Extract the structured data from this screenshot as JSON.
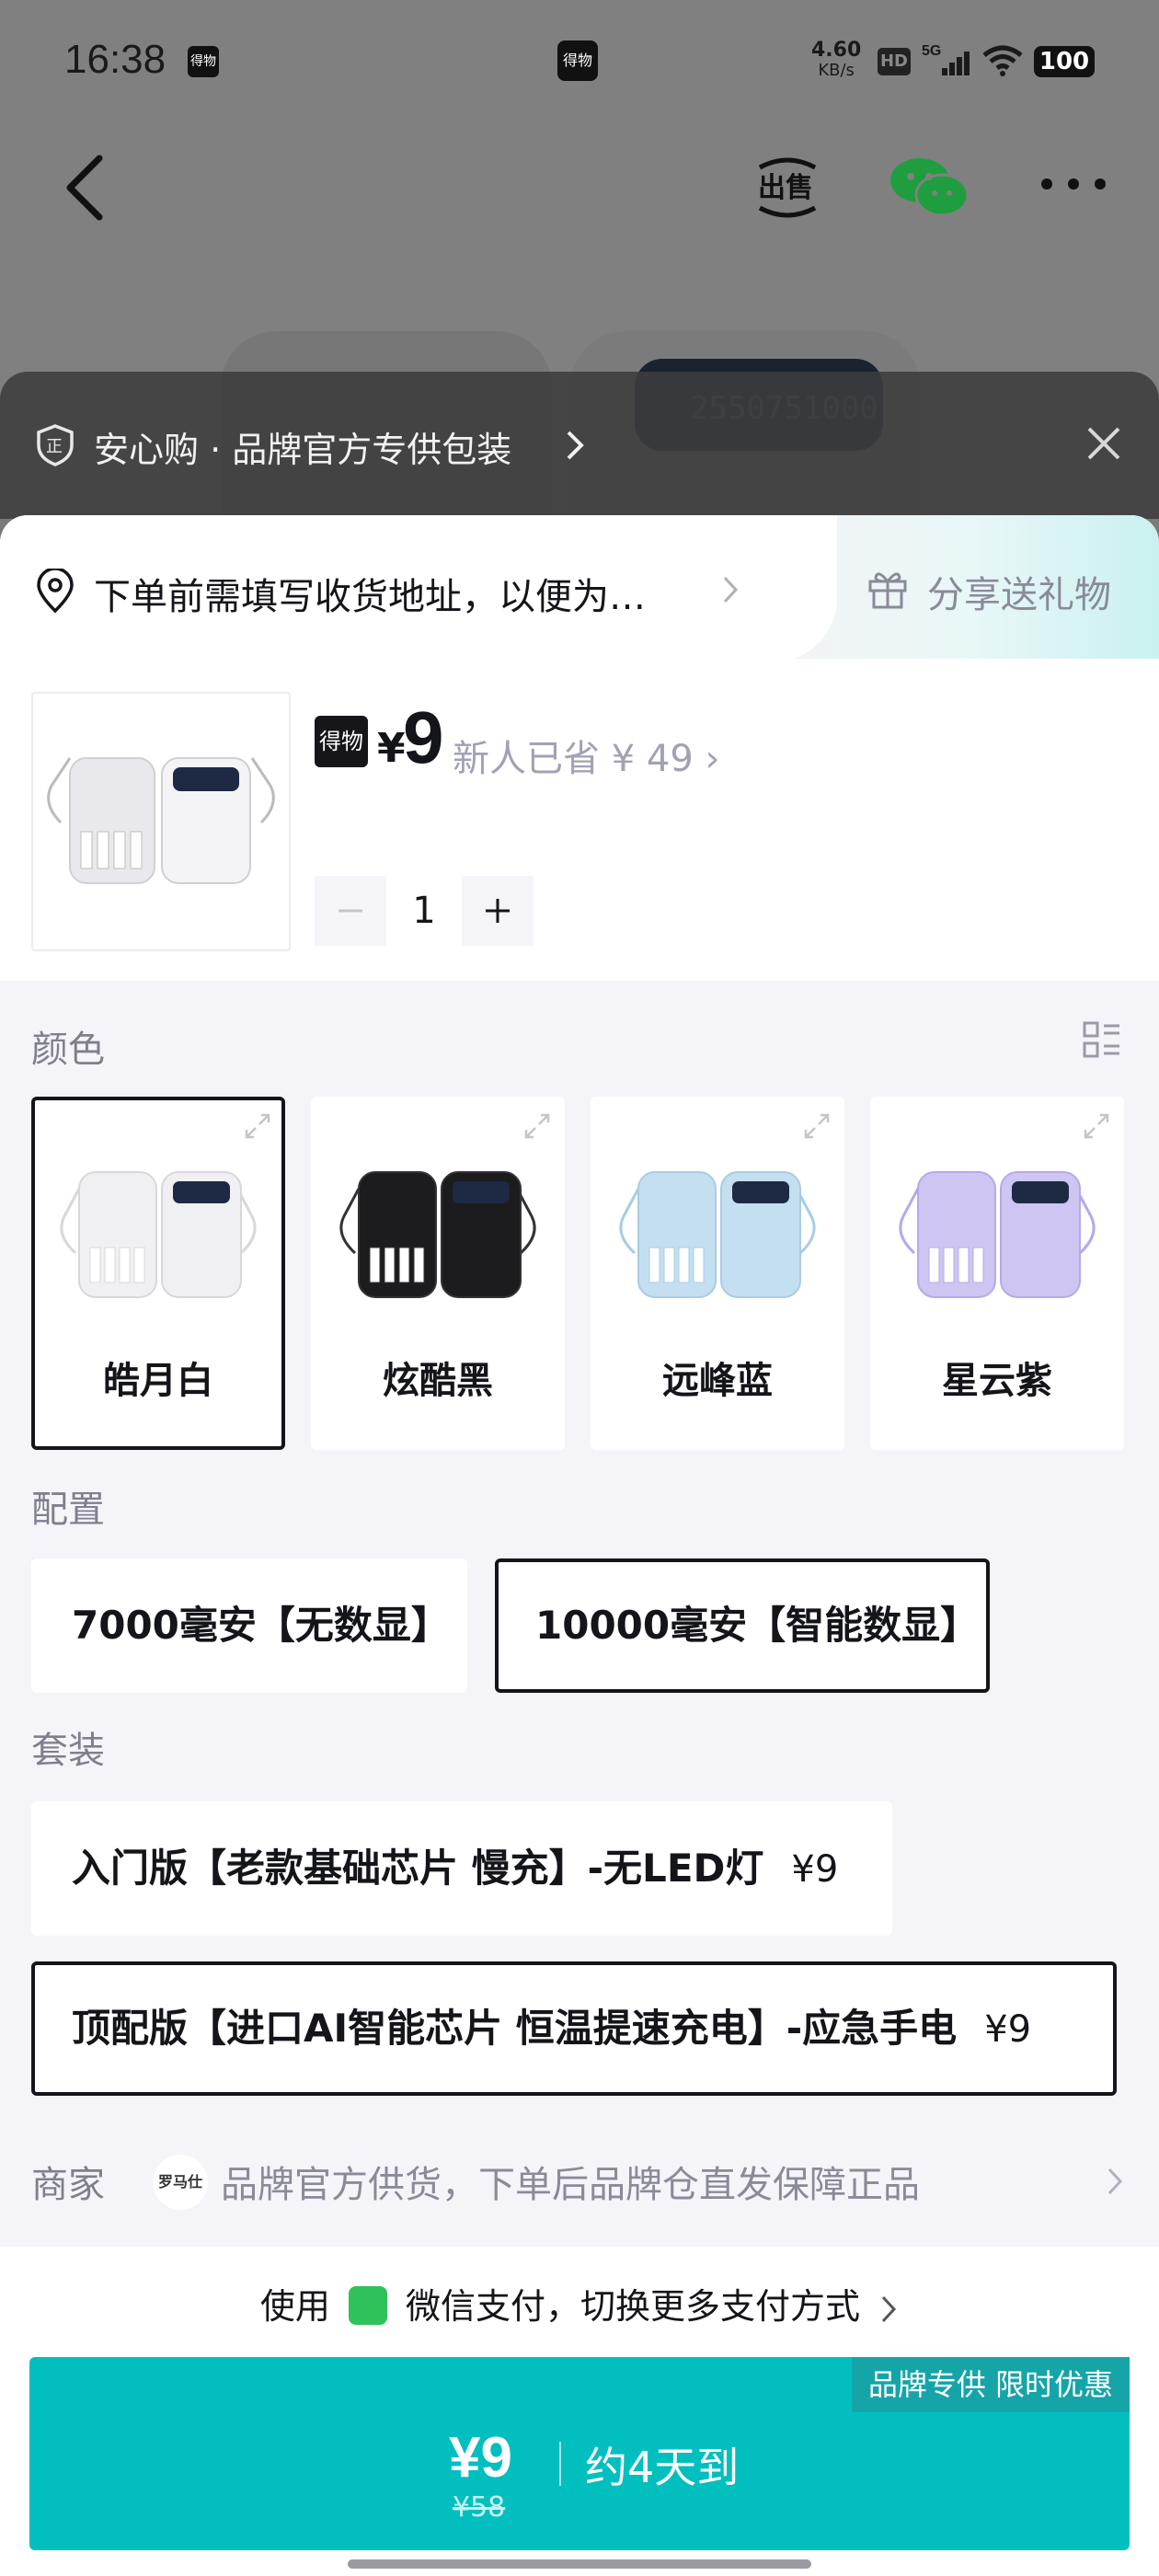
{
  "status_bar": {
    "time": "16:38",
    "app_icon_text": "得物",
    "center_icon_text": "得物",
    "net_speed_value": "4.60",
    "net_speed_unit": "KB/s",
    "hd_label": "HD",
    "network": "5G",
    "battery": "100"
  },
  "nav": {
    "back_icon": "chevron-left-icon",
    "sell_icon": "sell-icon",
    "sell_icon_text": "出售",
    "share_icon": "wechat-icon",
    "more_icon": "more-icon"
  },
  "assurance": {
    "text": "安心购 · 品牌官方专供包装",
    "icon": "shield-icon",
    "close_icon": "close-icon"
  },
  "address": {
    "text": "下单前需填写收货地址，以便为…"
  },
  "gift": {
    "label": "分享送礼物"
  },
  "product": {
    "logo_text": "得物",
    "currency": "¥",
    "price": "9",
    "saved_text": "新人已省 ¥ 49",
    "quantity": "1"
  },
  "sections": {
    "color": "颜色",
    "config": "配置",
    "bundle": "套装",
    "merchant": "商家"
  },
  "colors": [
    {
      "name": "皓月白",
      "selected": true,
      "body": "#f0f0f2",
      "shade": "#d8d8dc"
    },
    {
      "name": "炫酷黑",
      "selected": false,
      "body": "#1c1c1e",
      "shade": "#333336"
    },
    {
      "name": "远峰蓝",
      "selected": false,
      "body": "#c4dff0",
      "shade": "#a8cce3"
    },
    {
      "name": "星云紫",
      "selected": false,
      "body": "#cec5f2",
      "shade": "#b6a9ea"
    }
  ],
  "configs": [
    {
      "label": "7000毫安【无数显】",
      "selected": false
    },
    {
      "label": "10000毫安【智能数显】",
      "selected": true
    }
  ],
  "bundles": [
    {
      "label": "入门版【老款基础芯片 慢充】-无LED灯",
      "price": "¥9",
      "selected": false
    },
    {
      "label": "顶配版【进口AI智能芯片 恒温提速充电】-应急手电",
      "price": "¥9",
      "selected": true
    }
  ],
  "merchant": {
    "logo_text": "罗马仕",
    "text": "品牌官方供货，下单后品牌仓直发保障正品"
  },
  "payment": {
    "prefix": "使用",
    "method": "微信支付，切换更多支付方式"
  },
  "buy": {
    "badge": "品牌专供 限时优惠",
    "price": "¥9",
    "original_price": "¥58",
    "eta": "约4天到"
  },
  "accent_colors": {
    "primary": "#01bfbf",
    "badge": "#15a5a9",
    "wechat": "#2fc15a"
  }
}
